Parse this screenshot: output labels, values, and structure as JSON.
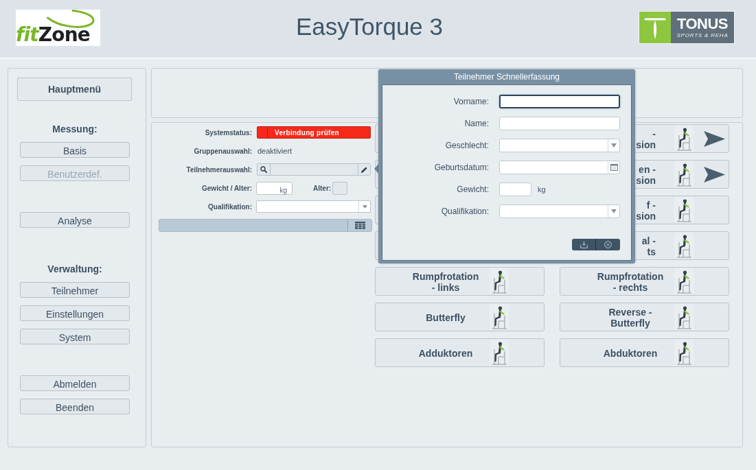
{
  "header": {
    "title": "EasyTorque 3",
    "left_logo": {
      "wordmark": [
        "fit",
        "Zone"
      ]
    },
    "right_logo": {
      "name": "TONUS",
      "tagline": "SPORTS & REHA"
    }
  },
  "sidebar": {
    "main_button": "Hauptmenü",
    "groups": [
      {
        "heading": "Messung:",
        "buttons": [
          {
            "label": "Basis",
            "disabled": false
          },
          {
            "label": "Benutzerdef.",
            "disabled": true
          }
        ]
      },
      {
        "buttons": [
          {
            "label": "Analyse",
            "disabled": false
          }
        ]
      },
      {
        "heading": "Verwaltung:",
        "buttons": [
          {
            "label": "Teilnehmer",
            "disabled": false
          },
          {
            "label": "Einstellungen",
            "disabled": false
          },
          {
            "label": "System",
            "disabled": false
          }
        ]
      },
      {
        "buttons": [
          {
            "label": "Abmelden",
            "disabled": false
          },
          {
            "label": "Beenden",
            "disabled": false
          }
        ]
      }
    ]
  },
  "participant_form": {
    "rows": [
      {
        "kind": "status",
        "label": "Systemstatus:",
        "value": "Verbindung prüfen",
        "error": true
      },
      {
        "kind": "text",
        "label": "Gruppenauswahl:",
        "value": "deaktiviert"
      },
      {
        "kind": "search",
        "label": "Teilnehmerauswahl:"
      },
      {
        "kind": "weight_age",
        "label": "Gewicht / Alter:",
        "unit": "kg",
        "age_label": "Alter:"
      },
      {
        "kind": "select",
        "label": "Qualifikation:"
      }
    ]
  },
  "exercises": [
    {
      "covered": true
    },
    {
      "label": "-\nsion",
      "covered": true,
      "arrow": true
    },
    {
      "covered": true
    },
    {
      "label": "en -\nsion",
      "covered": true,
      "arrow": true
    },
    {
      "covered": true
    },
    {
      "label": "f -\nsion",
      "covered": true,
      "arrow": false
    },
    {
      "covered": true
    },
    {
      "label": "al -\nts",
      "covered": true,
      "arrow": false
    },
    {
      "label": "Rumpfrotation\n- links",
      "covered": false,
      "arrow": false
    },
    {
      "label": "Rumpfrotation\n- rechts",
      "covered": false,
      "arrow": false
    },
    {
      "label": "Butterfly",
      "covered": false,
      "arrow": false
    },
    {
      "label": "Reverse -\nButterfly",
      "covered": false,
      "arrow": false
    },
    {
      "label": "Adduktoren",
      "covered": false,
      "arrow": false
    },
    {
      "label": "Abduktoren",
      "covered": false,
      "arrow": false
    }
  ],
  "dialog": {
    "title": "Teilnehmer Schnellerfassung",
    "fields": [
      {
        "kind": "text",
        "label": "Vorname:",
        "focused": true
      },
      {
        "kind": "text",
        "label": "Name:",
        "focused": false
      },
      {
        "kind": "select",
        "label": "Geschlecht:",
        "focused": false
      },
      {
        "kind": "date",
        "label": "Geburtsdatum:",
        "focused": false
      },
      {
        "kind": "unit",
        "label": "Gewicht:",
        "unit": "kg",
        "focused": false
      },
      {
        "kind": "select",
        "label": "Qualifikation:",
        "focused": false
      }
    ],
    "buttons": [
      {
        "kind": "save"
      },
      {
        "kind": "cancel"
      }
    ]
  }
}
